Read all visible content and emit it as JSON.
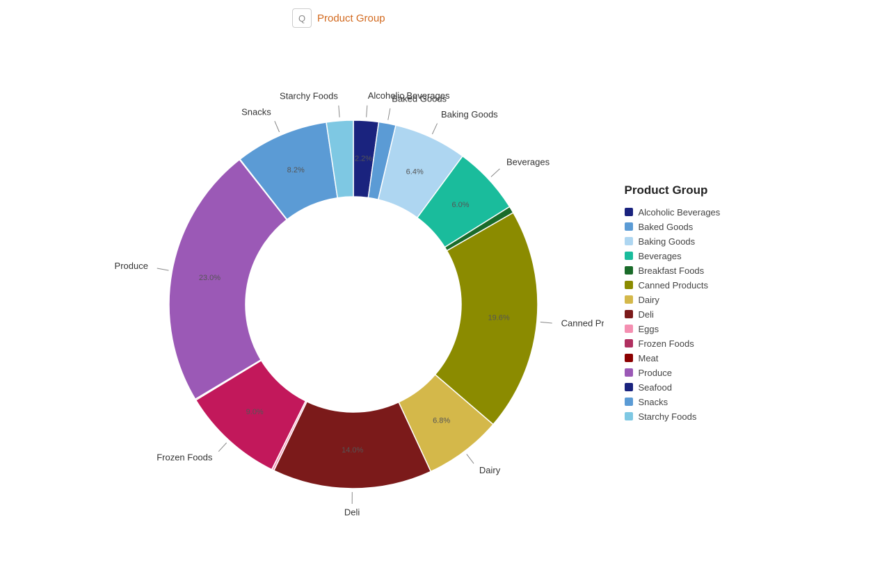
{
  "header": {
    "icon": "🔍",
    "title": "Product Group"
  },
  "legend": {
    "title": "Product Group",
    "items": [
      {
        "label": "Alcoholic Beverages",
        "color": "#1a237e"
      },
      {
        "label": "Baked Goods",
        "color": "#5b9bd5"
      },
      {
        "label": "Baking Goods",
        "color": "#aed6f1"
      },
      {
        "label": "Beverages",
        "color": "#1abc9c"
      },
      {
        "label": "Breakfast Foods",
        "color": "#1a6b2a"
      },
      {
        "label": "Canned Products",
        "color": "#8b8b00"
      },
      {
        "label": "Dairy",
        "color": "#d4b84a"
      },
      {
        "label": "Deli",
        "color": "#7b1a1a"
      },
      {
        "label": "Eggs",
        "color": "#f48fb1"
      },
      {
        "label": "Frozen Foods",
        "color": "#b03060"
      },
      {
        "label": "Meat",
        "color": "#8b0000"
      },
      {
        "label": "Produce",
        "color": "#9b59b6"
      },
      {
        "label": "Seafood",
        "color": "#1a237e"
      },
      {
        "label": "Snacks",
        "color": "#5b9bd5"
      },
      {
        "label": "Starchy Foods",
        "color": "#7ec8e3"
      }
    ]
  },
  "segments": [
    {
      "label": "Alcoholic Beverages",
      "pct": "2.2%",
      "color": "#1a237e"
    },
    {
      "label": "Baked Goods",
      "pct": "",
      "color": "#5b9bd5"
    },
    {
      "label": "Baking Goods",
      "pct": "6.4%",
      "color": "#aed6f1"
    },
    {
      "label": "Beverages",
      "pct": "6.0%",
      "color": "#1abc9c"
    },
    {
      "label": "Breakfast Foods",
      "pct": "0.6%",
      "color": "#1a6b2a"
    },
    {
      "label": "Canned Products",
      "pct": "19.6%",
      "color": "#8b8b00"
    },
    {
      "label": "Dairy",
      "pct": "6.8%",
      "color": "#d4b84a"
    },
    {
      "label": "Deli",
      "pct": "14.0%",
      "color": "#7b1a1a"
    },
    {
      "label": "Eggs",
      "pct": "0.2%",
      "color": "#f48fb1"
    },
    {
      "label": "Frozen Foods",
      "pct": "9.0%",
      "color": "#b03060"
    },
    {
      "label": "Meat",
      "pct": "0.1%",
      "color": "#8b0000"
    },
    {
      "label": "Produce",
      "pct": "23.0%",
      "color": "#9b59b6"
    },
    {
      "label": "Seafood",
      "pct": "0.0%",
      "color": "#1a237e"
    },
    {
      "label": "Snacks",
      "pct": "8.2%",
      "color": "#5b9bd5"
    },
    {
      "label": "Starchy Foods",
      "pct": "",
      "color": "#7ec8e3"
    }
  ]
}
